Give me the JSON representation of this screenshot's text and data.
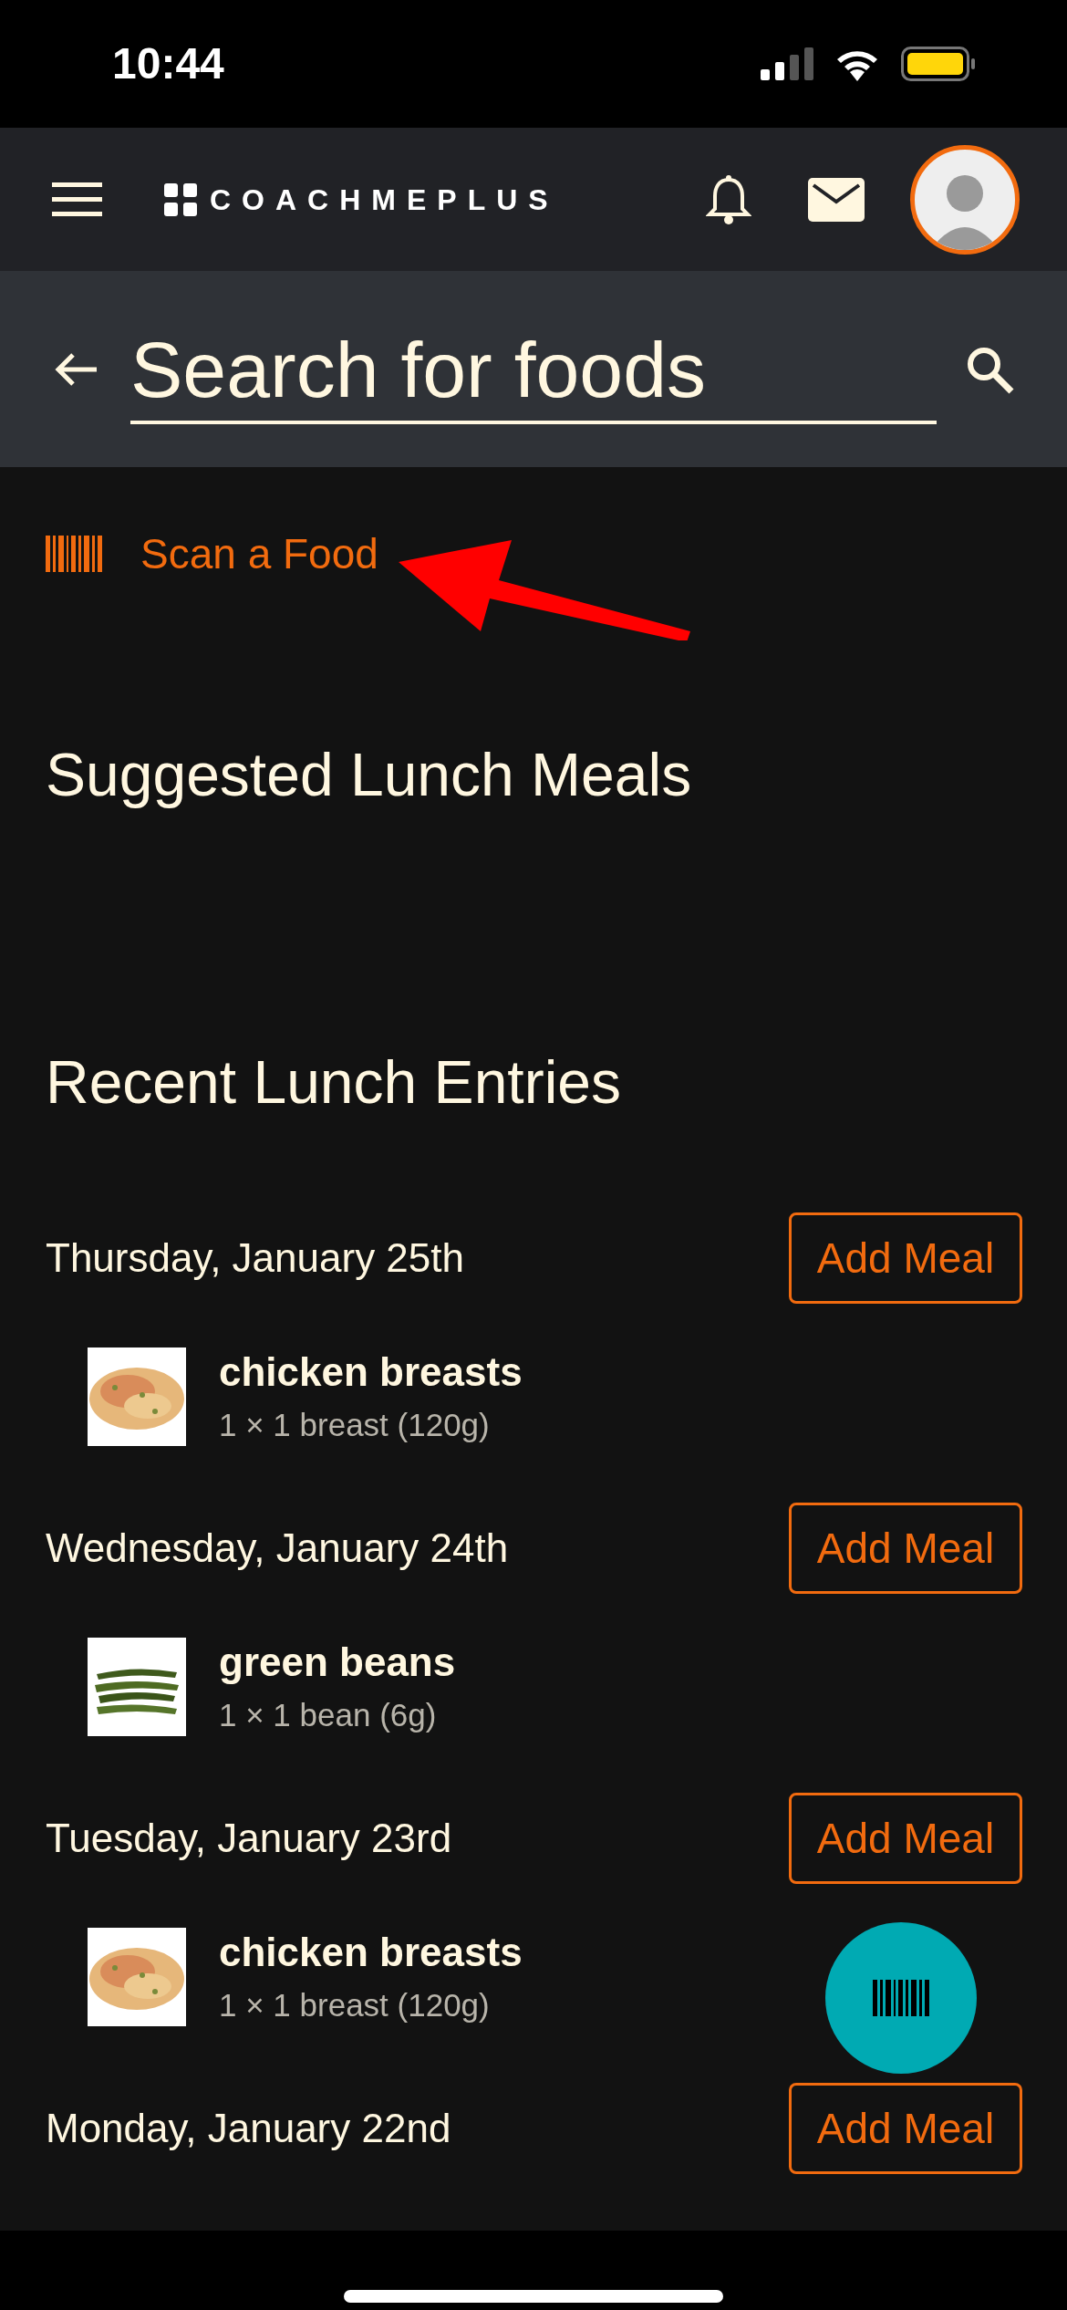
{
  "status_bar": {
    "time": "10:44"
  },
  "header": {
    "logo": "COACHMEPLUS"
  },
  "search": {
    "placeholder": "Search for foods"
  },
  "scan_link": {
    "label": "Scan a Food"
  },
  "suggested": {
    "title": "Suggested Lunch Meals"
  },
  "recent": {
    "title": "Recent Lunch Entries",
    "days": [
      {
        "date": "Thursday, January 25th",
        "button": "Add Meal",
        "foods": [
          {
            "name": "chicken breasts",
            "serving": "1 × 1 breast (120g)"
          }
        ]
      },
      {
        "date": "Wednesday, January 24th",
        "button": "Add Meal",
        "foods": [
          {
            "name": "green beans",
            "serving": "1 × 1 bean (6g)"
          }
        ]
      },
      {
        "date": "Tuesday, January 23rd",
        "button": "Add Meal",
        "foods": [
          {
            "name": "chicken breasts",
            "serving": "1 × 1 breast (120g)"
          }
        ]
      },
      {
        "date": "Monday, January 22nd",
        "button": "Add Meal"
      }
    ]
  }
}
